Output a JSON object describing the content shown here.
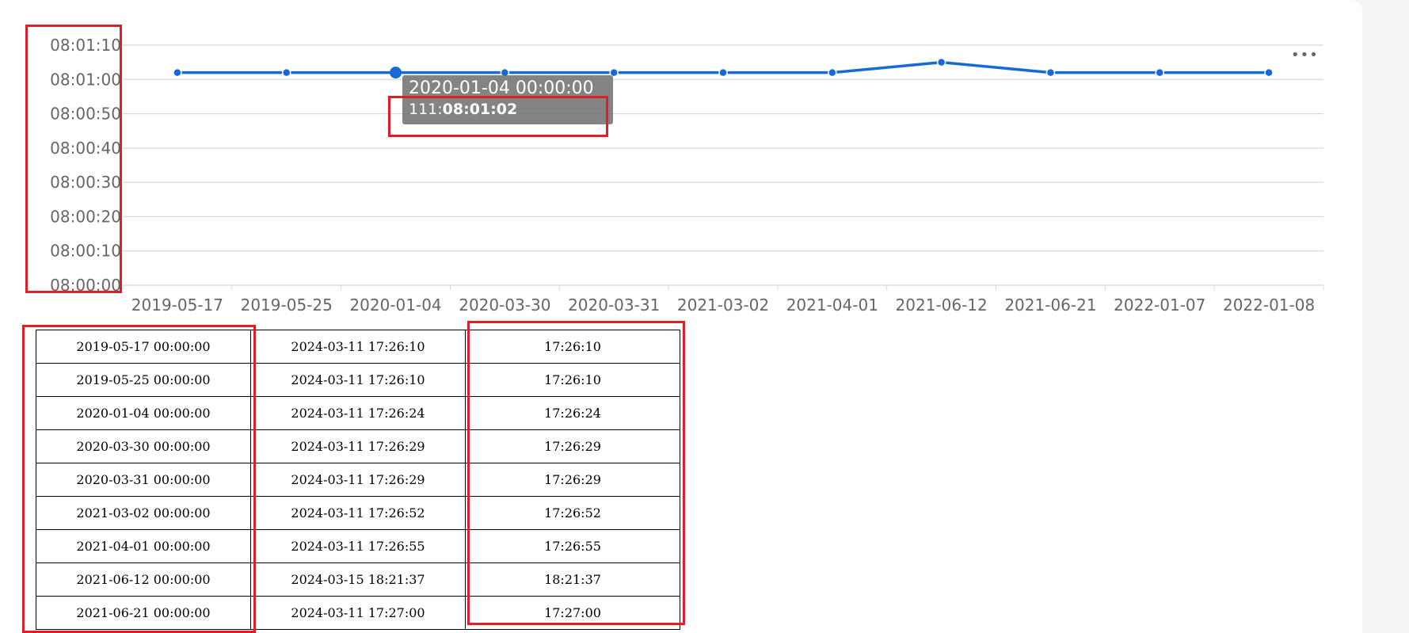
{
  "chart_data": {
    "type": "line",
    "x_categories": [
      "2019-05-17",
      "2019-05-25",
      "2020-01-04",
      "2020-03-30",
      "2020-03-31",
      "2021-03-02",
      "2021-04-01",
      "2021-06-12",
      "2021-06-21",
      "2022-01-07",
      "2022-01-08"
    ],
    "y_ticks": [
      "08:00:00",
      "08:00:10",
      "08:00:20",
      "08:00:30",
      "08:00:40",
      "08:00:50",
      "08:01:00",
      "08:01:10"
    ],
    "ylim": [
      "08:00:00",
      "08:01:10"
    ],
    "series": [
      {
        "name": "111",
        "values": [
          "08:01:02",
          "08:01:02",
          "08:01:02",
          "08:01:02",
          "08:01:02",
          "08:01:02",
          "08:01:02",
          "08:01:05",
          "08:01:02",
          "08:01:02",
          "08:01:02"
        ]
      }
    ],
    "highlighted_index": 2,
    "grid": true,
    "colors": {
      "line": "#1669d6",
      "grid": "#d7d7d7",
      "axis_text": "#666666"
    }
  },
  "tooltip": {
    "title": "2020-01-04 00:00:00",
    "series_prefix": "111:",
    "value": "08:01:02"
  },
  "toolbar": {
    "more_label": "•••"
  },
  "table": {
    "rows": [
      [
        "2019-05-17 00:00:00",
        "2024-03-11 17:26:10",
        "17:26:10"
      ],
      [
        "2019-05-25 00:00:00",
        "2024-03-11 17:26:10",
        "17:26:10"
      ],
      [
        "2020-01-04 00:00:00",
        "2024-03-11 17:26:24",
        "17:26:24"
      ],
      [
        "2020-03-30 00:00:00",
        "2024-03-11 17:26:29",
        "17:26:29"
      ],
      [
        "2020-03-31 00:00:00",
        "2024-03-11 17:26:29",
        "17:26:29"
      ],
      [
        "2021-03-02 00:00:00",
        "2024-03-11 17:26:52",
        "17:26:52"
      ],
      [
        "2021-04-01 00:00:00",
        "2024-03-11 17:26:55",
        "17:26:55"
      ],
      [
        "2021-06-12 00:00:00",
        "2024-03-15 18:21:37",
        "18:21:37"
      ],
      [
        "2021-06-21 00:00:00",
        "2024-03-11 17:27:00",
        "17:27:00"
      ]
    ]
  },
  "colors": {
    "highlight": "#e01e26",
    "tooltip_bg": "#6e6e6e"
  }
}
